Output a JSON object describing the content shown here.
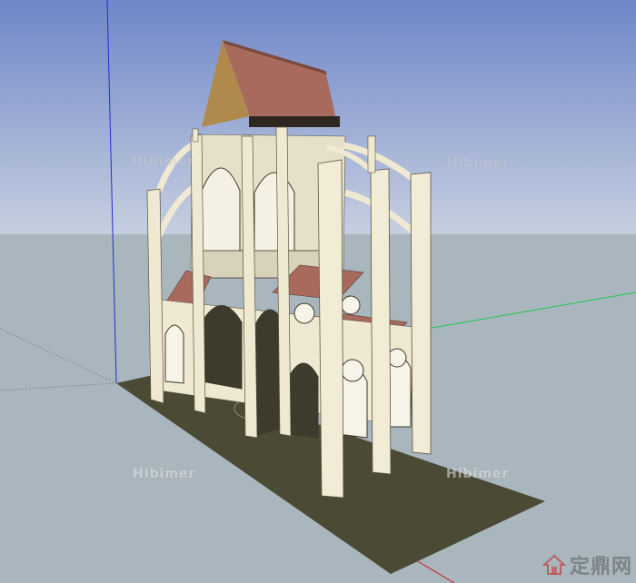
{
  "scene": {
    "title": "",
    "model": "gothic-cathedral-section",
    "colors": {
      "sky_top": "#6f86c8",
      "sky_bottom": "#c6cfe0",
      "ground": "#a9b6be",
      "floor_base": "#4b4a35",
      "stone": "#efe9d2",
      "stone_shadow": "#c8c2ab",
      "roof": "#a86a5c",
      "roof_dark": "#7a4a3e",
      "roof_shadow": "#b08a4c",
      "axis_blue": "#1e2fd0",
      "axis_red": "#d01e1e",
      "axis_green": "#1ec84a"
    }
  },
  "watermarks": [
    {
      "label": "Hibimer"
    },
    {
      "label": "Hibimer"
    },
    {
      "label": "Hibimer"
    },
    {
      "label": "Hibimer"
    }
  ],
  "brand": {
    "icon": "house-logo-icon",
    "label": "定鼎网"
  }
}
